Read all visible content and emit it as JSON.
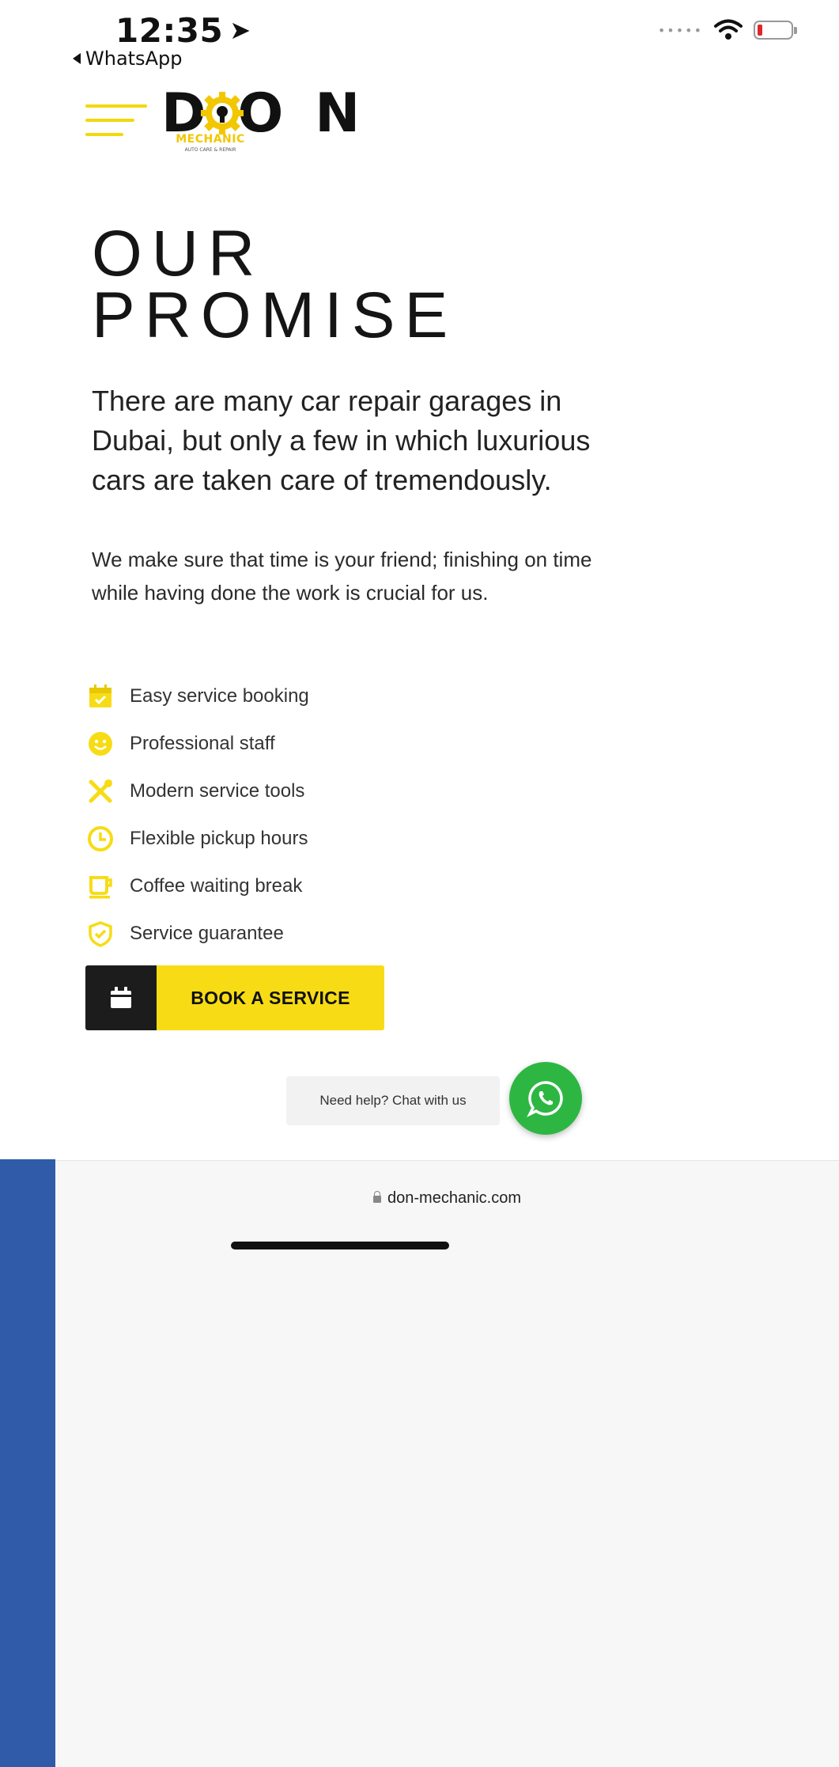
{
  "status_bar": {
    "time": "12:35",
    "back_app": "WhatsApp",
    "icons": [
      "location-arrow-icon",
      "wifi-icon",
      "battery-icon"
    ]
  },
  "header": {
    "logo_word": "DON",
    "logo_sub": "MECHANIC",
    "logo_tag": "AUTO CARE & REPAIR",
    "menu_icon": "hamburger-icon"
  },
  "main": {
    "headline_line1": "OUR",
    "headline_line2": "PROMISE",
    "intro": "There are many car repair garages in Dubai, but only a few in which luxurious cars are taken care of tremendously.",
    "body": "We make sure that time is your friend; finishing on time while having done the work is crucial for us.",
    "features": [
      {
        "label": "Easy service booking",
        "icon": "calendar-check-icon"
      },
      {
        "label": "Professional staff",
        "icon": "smiley-icon"
      },
      {
        "label": "Modern service tools",
        "icon": "tools-icon"
      },
      {
        "label": "Flexible pickup hours",
        "icon": "clock-icon"
      },
      {
        "label": "Coffee waiting break",
        "icon": "coffee-cup-icon"
      },
      {
        "label": "Service guarantee",
        "icon": "shield-check-icon"
      }
    ],
    "cta_label": "BOOK A SERVICE"
  },
  "chat": {
    "label": "Need help? Chat with us",
    "icon": "whatsapp-icon"
  },
  "browser": {
    "url": "don-mechanic.com"
  },
  "colors": {
    "accent_yellow": "#f7dc15",
    "dark": "#1c1c1c",
    "whatsapp_green": "#2db742",
    "side_strip_blue": "#2f5ba8"
  }
}
